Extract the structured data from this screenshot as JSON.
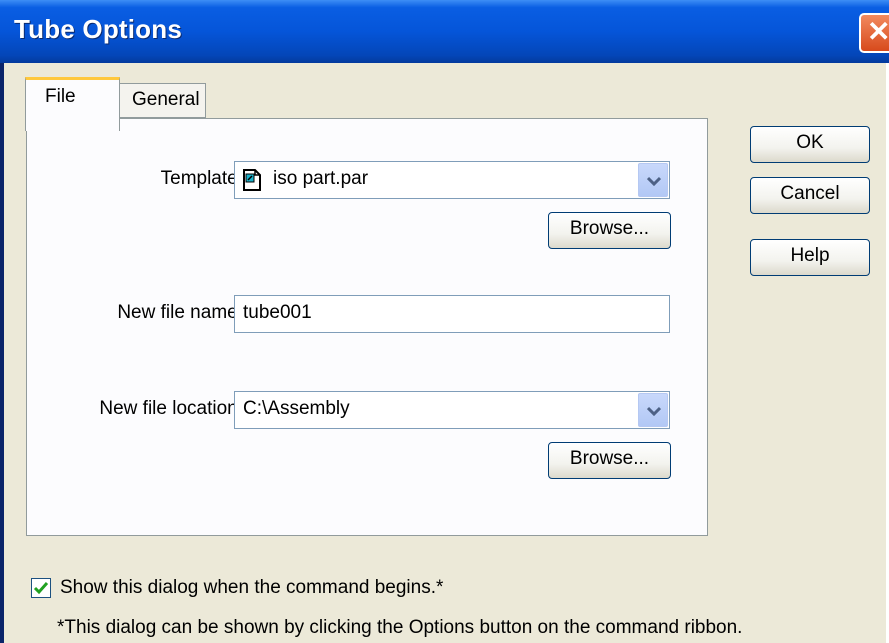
{
  "window": {
    "title": "Tube Options",
    "close_symbol": "✕"
  },
  "tabs": [
    {
      "label": "File",
      "active": true
    },
    {
      "label": "General",
      "active": false
    }
  ],
  "file_tab": {
    "template": {
      "label": "Template:",
      "value": "iso part.par",
      "icon": "part-document-icon",
      "browse_label": "Browse..."
    },
    "new_file_name": {
      "label": "New file name:",
      "value": "tube001"
    },
    "new_file_location": {
      "label": "New file location:",
      "value": "C:\\Assembly",
      "browse_label": "Browse..."
    }
  },
  "buttons": {
    "ok": "OK",
    "cancel": "Cancel",
    "help": "Help"
  },
  "show_dialog": {
    "label": "Show this dialog when the command begins.*",
    "checked": true
  },
  "footnote": "*This dialog can be shown by clicking the Options button on the command ribbon.",
  "colors": {
    "titlebar": "#0555d9",
    "dialog_face": "#ece9d8",
    "tab_highlight": "#ffc83c",
    "close_button": "#d74a1c"
  }
}
